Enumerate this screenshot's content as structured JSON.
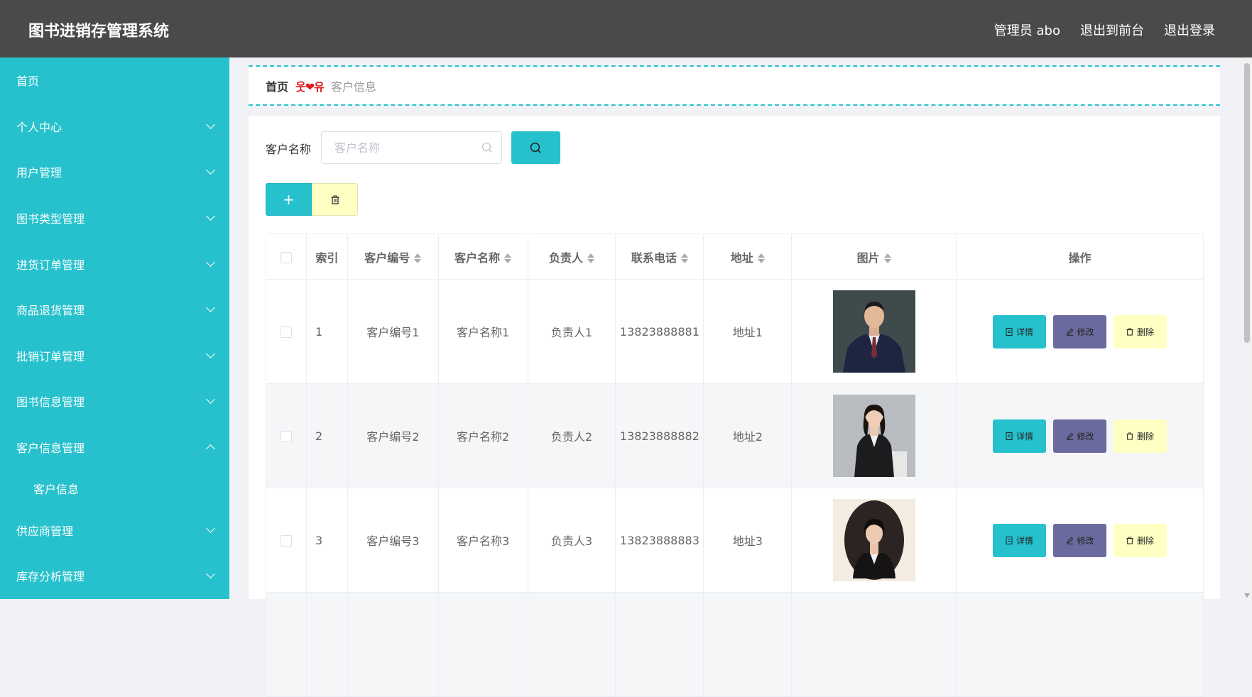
{
  "header": {
    "title": "图书进销存管理系统",
    "user": "管理员 abo",
    "front": "退出到前台",
    "logout": "退出登录"
  },
  "sidebar": {
    "items": [
      {
        "label": "首页",
        "chevron": ""
      },
      {
        "label": "个人中心",
        "chevron": "down"
      },
      {
        "label": "用户管理",
        "chevron": "down"
      },
      {
        "label": "图书类型管理",
        "chevron": "down"
      },
      {
        "label": "进货订单管理",
        "chevron": "down"
      },
      {
        "label": "商品退货管理",
        "chevron": "down"
      },
      {
        "label": "批销订单管理",
        "chevron": "down"
      },
      {
        "label": "图书信息管理",
        "chevron": "down"
      },
      {
        "label": "客户信息管理",
        "chevron": "up"
      },
      {
        "label": "客户信息",
        "chevron": "sub"
      },
      {
        "label": "供应商管理",
        "chevron": "down"
      },
      {
        "label": "库存分析管理",
        "chevron": "down"
      }
    ]
  },
  "breadcrumb": {
    "home": "首页",
    "separator": "웃❤유",
    "current": "客户信息"
  },
  "search": {
    "label": "客户名称",
    "placeholder": "客户名称"
  },
  "table": {
    "headers": [
      "索引",
      "客户编号",
      "客户名称",
      "负责人",
      "联系电话",
      "地址",
      "图片",
      "操作"
    ],
    "rows": [
      {
        "index": "1",
        "code": "客户编号1",
        "name": "客户名称1",
        "owner": "负责人1",
        "phone": "13823888881",
        "address": "地址1"
      },
      {
        "index": "2",
        "code": "客户编号2",
        "name": "客户名称2",
        "owner": "负责人2",
        "phone": "13823888882",
        "address": "地址2"
      },
      {
        "index": "3",
        "code": "客户编号3",
        "name": "客户名称3",
        "owner": "负责人3",
        "phone": "13823888883",
        "address": "地址3"
      }
    ]
  },
  "actions": {
    "detail": "详情",
    "edit": "修改",
    "remove": "删除"
  },
  "colors": {
    "accent": "#26c1cd",
    "header_bg": "#4a4a4a",
    "edit": "#6a6a9e",
    "delete": "#ffffc4"
  }
}
